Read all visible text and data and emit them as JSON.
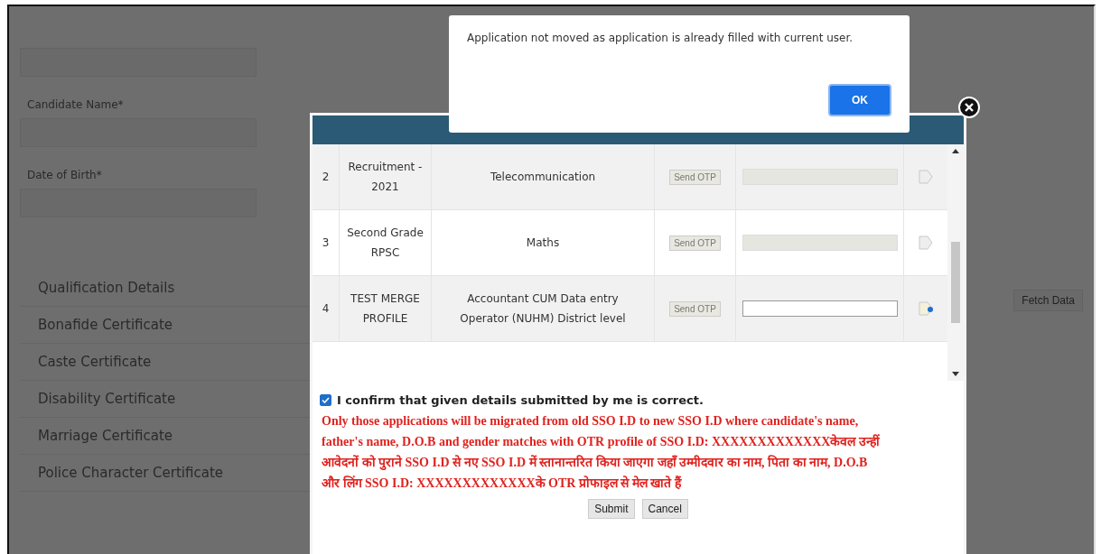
{
  "background_form": {
    "fields": [
      {
        "label": "Candidate Name*"
      },
      {
        "label": "Date of Birth*"
      }
    ],
    "fetch_button": "Fetch Data",
    "sections": [
      "Qualification Details",
      "Bonafide Certificate",
      "Caste Certificate",
      "Disability Certificate",
      "Marriage Certificate",
      "Police Character Certificate"
    ]
  },
  "modal": {
    "rows": [
      {
        "number": "2",
        "name": "Recruitment - 2021",
        "post": "Telecommunication",
        "send_otp": "Send OTP",
        "otp_disabled": true
      },
      {
        "number": "3",
        "name": "Second Grade RPSC",
        "post": "Maths",
        "send_otp": "Send OTP",
        "otp_disabled": true
      },
      {
        "number": "4",
        "name": "TEST MERGE PROFILE",
        "post": "Accountant CUM Data entry Operator (NUHM) District level",
        "send_otp": "Send OTP",
        "otp_disabled": false
      }
    ],
    "confirm": {
      "label": "I confirm that given details submitted by me is correct.",
      "checked": true
    },
    "notice": "Only those applications will be migrated from old SSO I.D to new SSO I.D where candidate's name, father's name, D.O.B and gender matches with OTR profile of SSO I.D: XXXXXXXXXXXXXकेवल उन्हीं आवेदनों को पुराने SSO I.D से नए SSO I.D में स्तानान्तरित किया जाएगा जहाँ उम्मीदवार का नाम, पिता का नाम, D.O.B और लिंग SSO I.D: XXXXXXXXXXXXXके OTR प्रोफाइल से मेल खाते हैं",
    "buttons": [
      "Submit",
      "Cancel"
    ]
  },
  "alert": {
    "message": "Application not moved as application is already filled with current user.",
    "button": "OK"
  }
}
